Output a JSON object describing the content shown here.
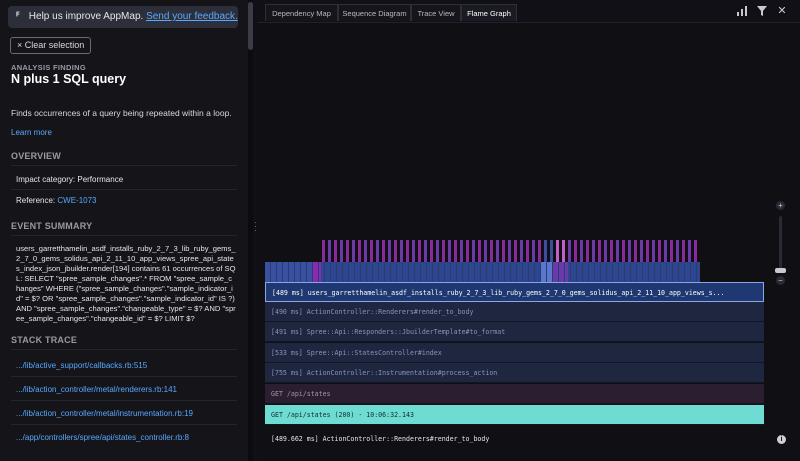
{
  "sidebar": {
    "feedback": {
      "text": "Help us improve AppMap.",
      "link": "Send your feedback."
    },
    "clear_selection": "Clear selection",
    "finding_label": "ANALYSIS FINDING",
    "finding_title": "N plus 1 SQL query",
    "description": "Finds occurrences of a query being repeated within a loop.",
    "learn_more": "Learn more",
    "overview_heading": "OVERVIEW",
    "impact_category": "Impact category: Performance",
    "reference_label": "Reference:",
    "reference_value": "CWE-1073",
    "event_summary_heading": "EVENT SUMMARY",
    "event_summary": "users_garretthamelin_asdf_installs_ruby_2_7_3_lib_ruby_gems_2_7_0_gems_solidus_api_2_11_10_app_views_spree_api_states_index_json_jbuilder.render[194] contains 61 occurrences of SQL: SELECT \"spree_sample_changes\".* FROM \"spree_sample_changes\" WHERE (\"spree_sample_changes\".\"sample_indicator_id\" = $? OR \"spree_sample_changes\".\"sample_indicator_id\" IS ?) AND \"spree_sample_changes\".\"changeable_type\" = $? AND \"spree_sample_changes\".\"changeable_id\" = $? LIMIT $?",
    "stack_trace_heading": "STACK TRACE",
    "stack_trace": [
      ".../lib/active_support/callbacks.rb:515",
      ".../lib/action_controller/metal/renderers.rb:141",
      ".../lib/action_controller/metal/instrumentation.rb:19",
      ".../app/controllers/spree/api/states_controller.rb:8"
    ]
  },
  "tabs": [
    "Dependency Map",
    "Sequence Diagram",
    "Trace View",
    "Flame Graph"
  ],
  "active_tab": "Flame Graph",
  "toolbar_icons": [
    "stats-icon",
    "filter-icon",
    "close-icon"
  ],
  "flame": {
    "rows": [
      "[489 ms] users_garretthamelin_asdf_installs_ruby_2_7_3_lib_ruby_gems_2_7_0_gems_solidus_api_2_11_10_app_views_s...",
      "[490 ms] ActionController::Renderers#render_to_body",
      "[491 ms] Spree::Api::Responders::JbuilderTemplate#to_format",
      "[533 ms] Spree::Api::StatesController#index",
      "[755 ms] ActionController::Instrumentation#process_action",
      "GET /api/states",
      "GET /api/states (200) - 10:06:32.143"
    ],
    "status": "[489.662 ms] ActionController::Renderers#render_to_body"
  },
  "colors": {
    "accent_link": "#5aa8ff",
    "selected_row": "#1f3872",
    "root_row": "#6fdcd4",
    "sql_magenta": "#8a2a9a",
    "sql_purple": "#6a3aaa"
  }
}
